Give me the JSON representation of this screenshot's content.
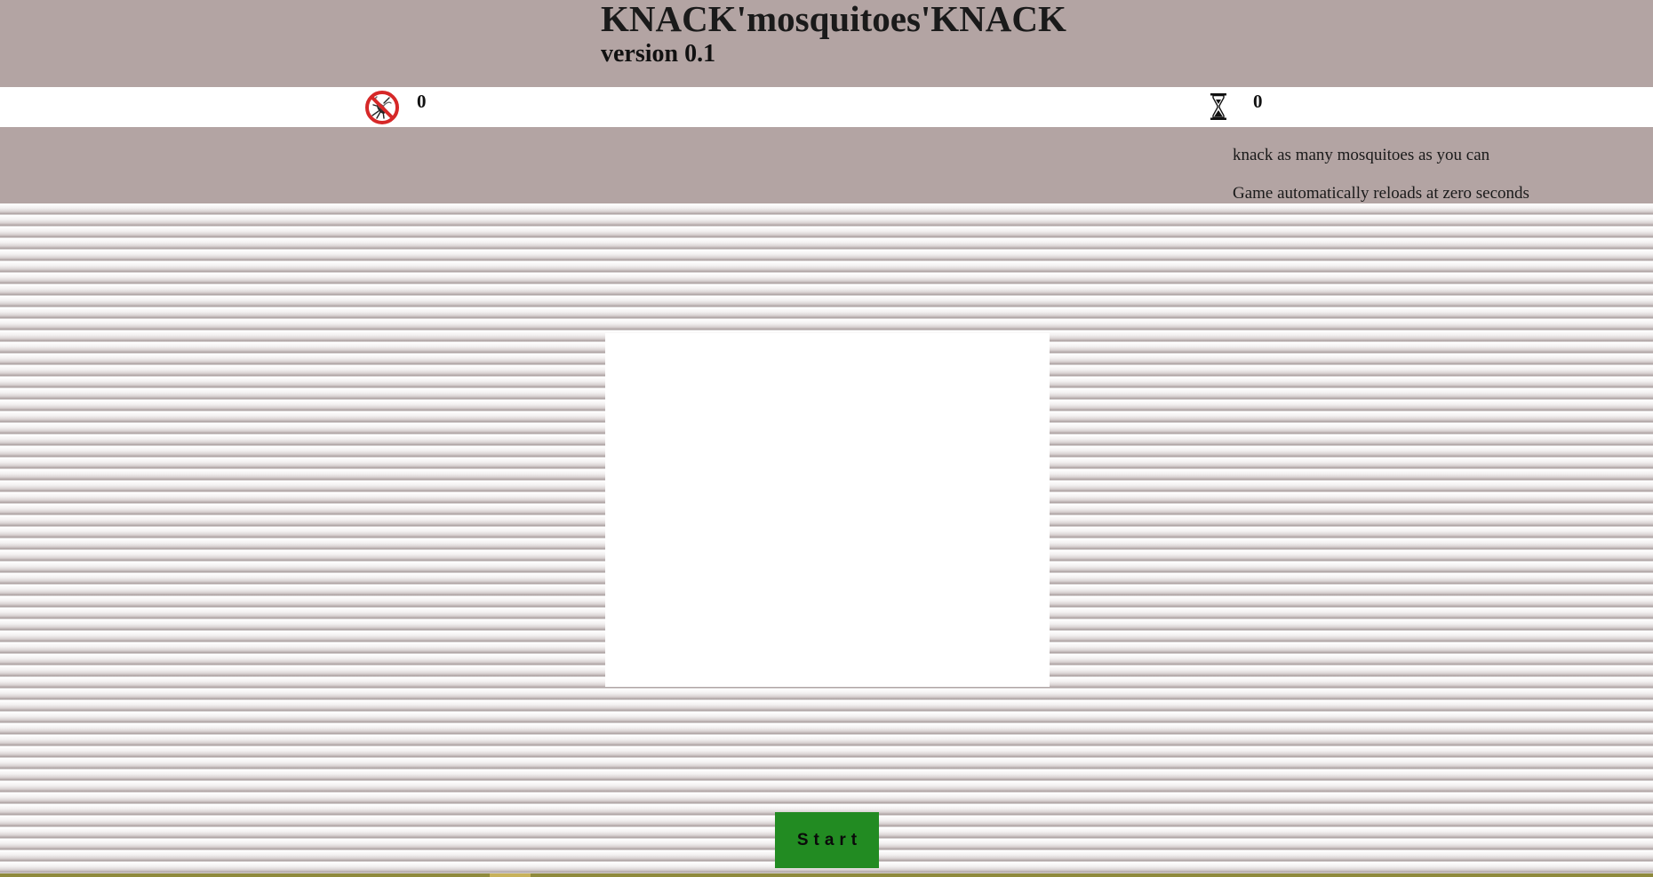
{
  "header": {
    "title": "KNACK'mosquitoes'KNACK",
    "version": "version 0.1"
  },
  "status": {
    "score_icon": "no-mosquito-icon",
    "score": "0",
    "timer_icon": "hourglass-icon",
    "timer": "0"
  },
  "instructions": {
    "line1": "knack as many mosquitoes as you can",
    "line2": "Game automatically reloads at zero seconds"
  },
  "controls": {
    "start_label": "Start"
  },
  "colors": {
    "header_bg": "#b3a4a3",
    "start_button": "#228b22",
    "no_sign_red": "#d62828"
  }
}
